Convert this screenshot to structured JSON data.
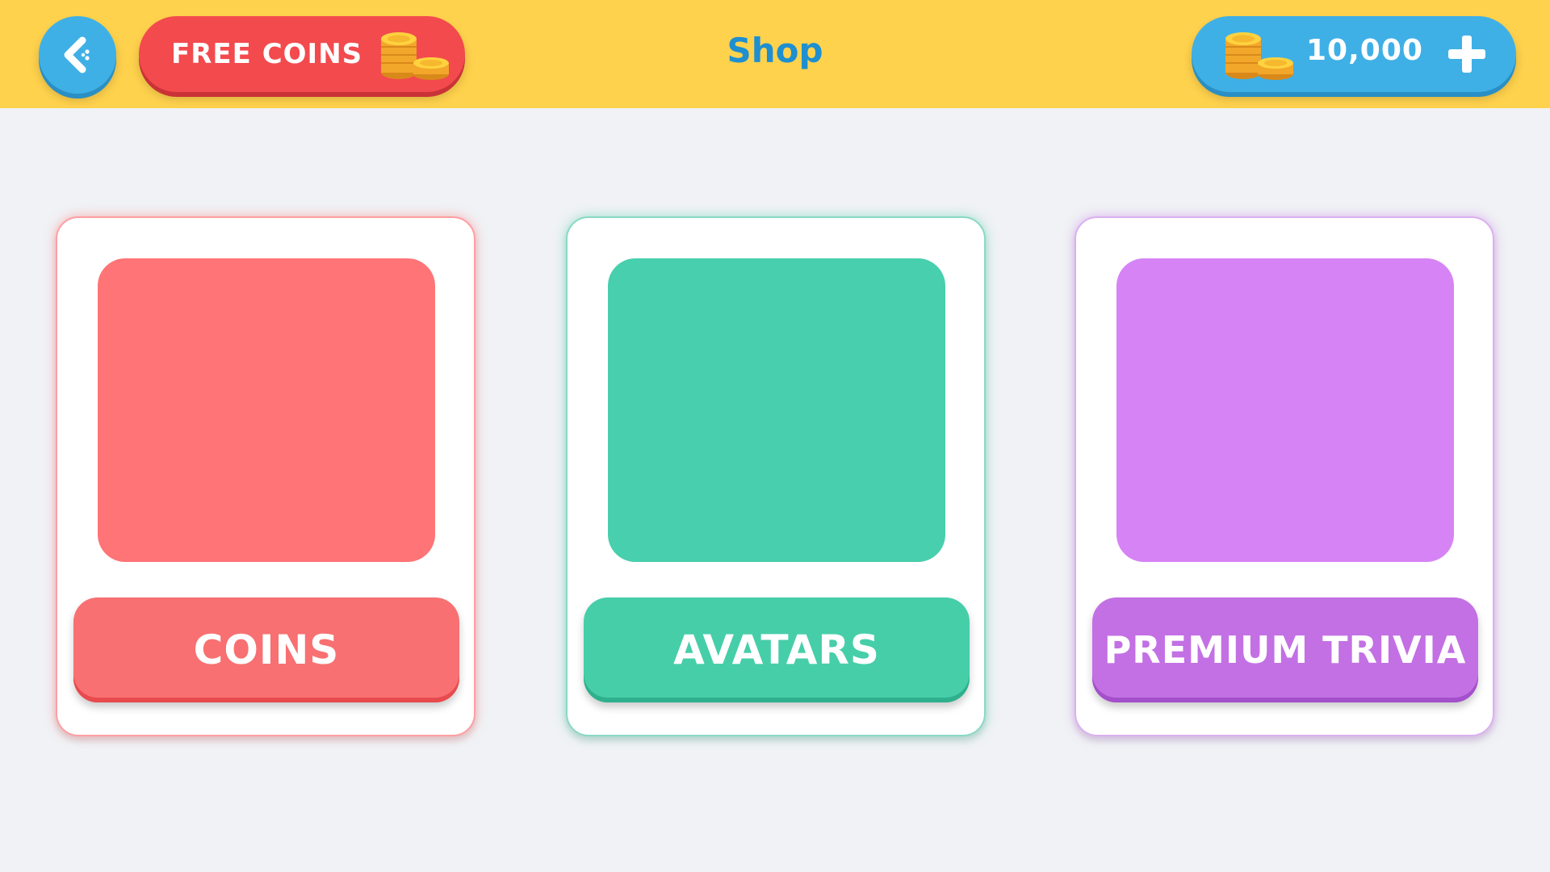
{
  "header": {
    "back_icon": "chevron-left-icon",
    "free_coins_label": "FREE COINS",
    "free_coins_icon": "coin-stack-icon",
    "title": "Shop",
    "balance_icon": "coin-stack-icon",
    "balance": "10,000",
    "add_icon": "plus-icon"
  },
  "cards": [
    {
      "label": "COINS",
      "color": "#ff7476"
    },
    {
      "label": "AVATARS",
      "color": "#48cfad"
    },
    {
      "label": "PREMIUM TRIVIA",
      "color": "#d683f5"
    }
  ],
  "colors": {
    "topbar": "#ffd24d",
    "accent_blue": "#3fb0e6",
    "free_coins_red": "#f34a4e",
    "title_blue": "#1e8fd0",
    "background": "#f0f2f5"
  }
}
